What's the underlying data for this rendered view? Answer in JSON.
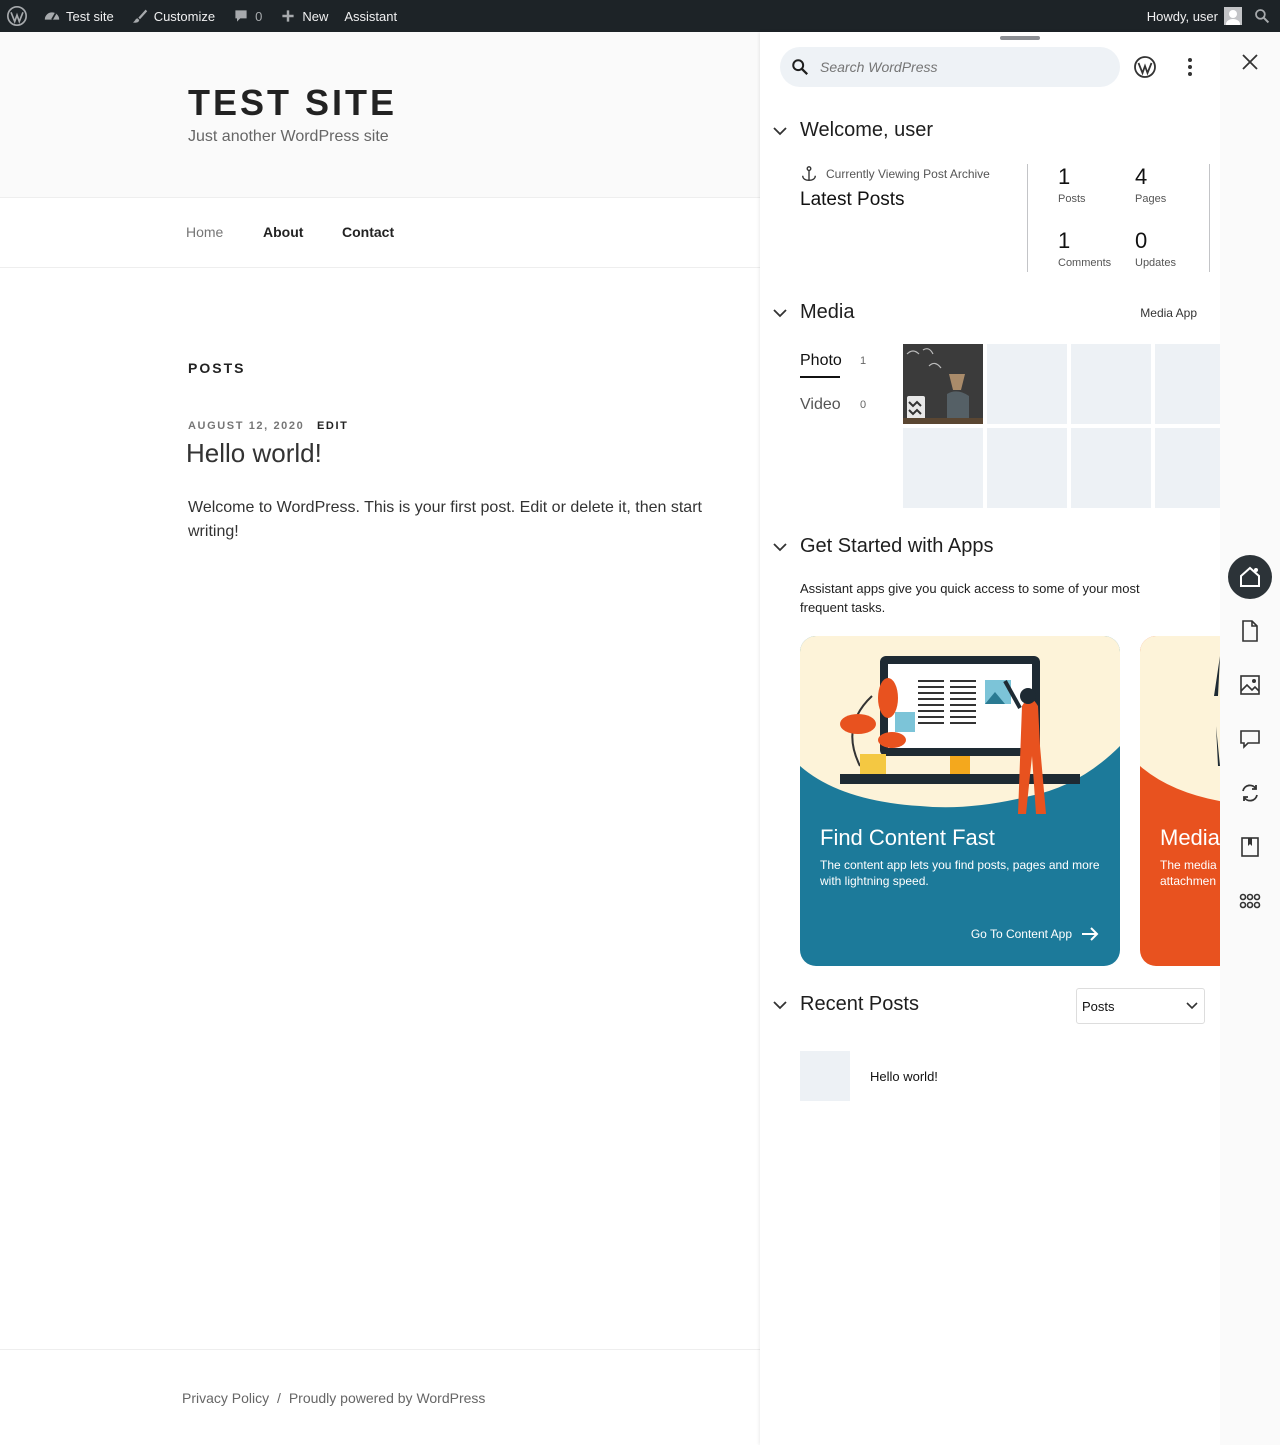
{
  "adminbar": {
    "site_name": "Test site",
    "customize": "Customize",
    "comments_count": "0",
    "new": "New",
    "assistant": "Assistant",
    "howdy": "Howdy, user"
  },
  "site": {
    "title": "TEST SITE",
    "tagline": "Just another WordPress site",
    "nav": [
      "Home",
      "About",
      "Contact"
    ],
    "section_label": "POSTS",
    "post": {
      "date": "AUGUST 12, 2020",
      "edit": "EDIT",
      "title": "Hello world!",
      "excerpt": "Welcome to WordPress. This is your first post. Edit or delete it, then start writing!"
    },
    "footer": {
      "privacy": "Privacy Policy",
      "separator": "/",
      "powered": "Proudly powered by WordPress"
    }
  },
  "assistant": {
    "search_placeholder": "Search WordPress",
    "welcome": {
      "title": "Welcome, user",
      "viewing_label": "Currently Viewing Post Archive",
      "viewing_title": "Latest Posts",
      "stats": [
        {
          "num": "1",
          "label": "Posts"
        },
        {
          "num": "4",
          "label": "Pages"
        },
        {
          "num": "1",
          "label": "Comments"
        },
        {
          "num": "0",
          "label": "Updates"
        }
      ]
    },
    "media": {
      "title": "Media",
      "app_link": "Media App",
      "tabs": [
        {
          "label": "Photo",
          "count": "1"
        },
        {
          "label": "Video",
          "count": "0"
        }
      ]
    },
    "apps": {
      "title": "Get Started with Apps",
      "description": "Assistant apps give you quick access to some of your most frequent tasks.",
      "cards": [
        {
          "title": "Find Content Fast",
          "description": "The content app lets you find posts, pages and more with lightning speed.",
          "link": "Go To Content App",
          "color": "#1c7a9a"
        },
        {
          "title": "Media",
          "description": "The media\nattachmen",
          "color": "#e8521f"
        }
      ]
    },
    "recent": {
      "title": "Recent Posts",
      "filter": "Posts",
      "items": [
        "Hello world!"
      ]
    }
  },
  "colors": {
    "adminbar": "#1d2327",
    "accent_blue": "#1c7a9a",
    "accent_orange": "#e8521f",
    "dock_active": "#2c3338"
  }
}
